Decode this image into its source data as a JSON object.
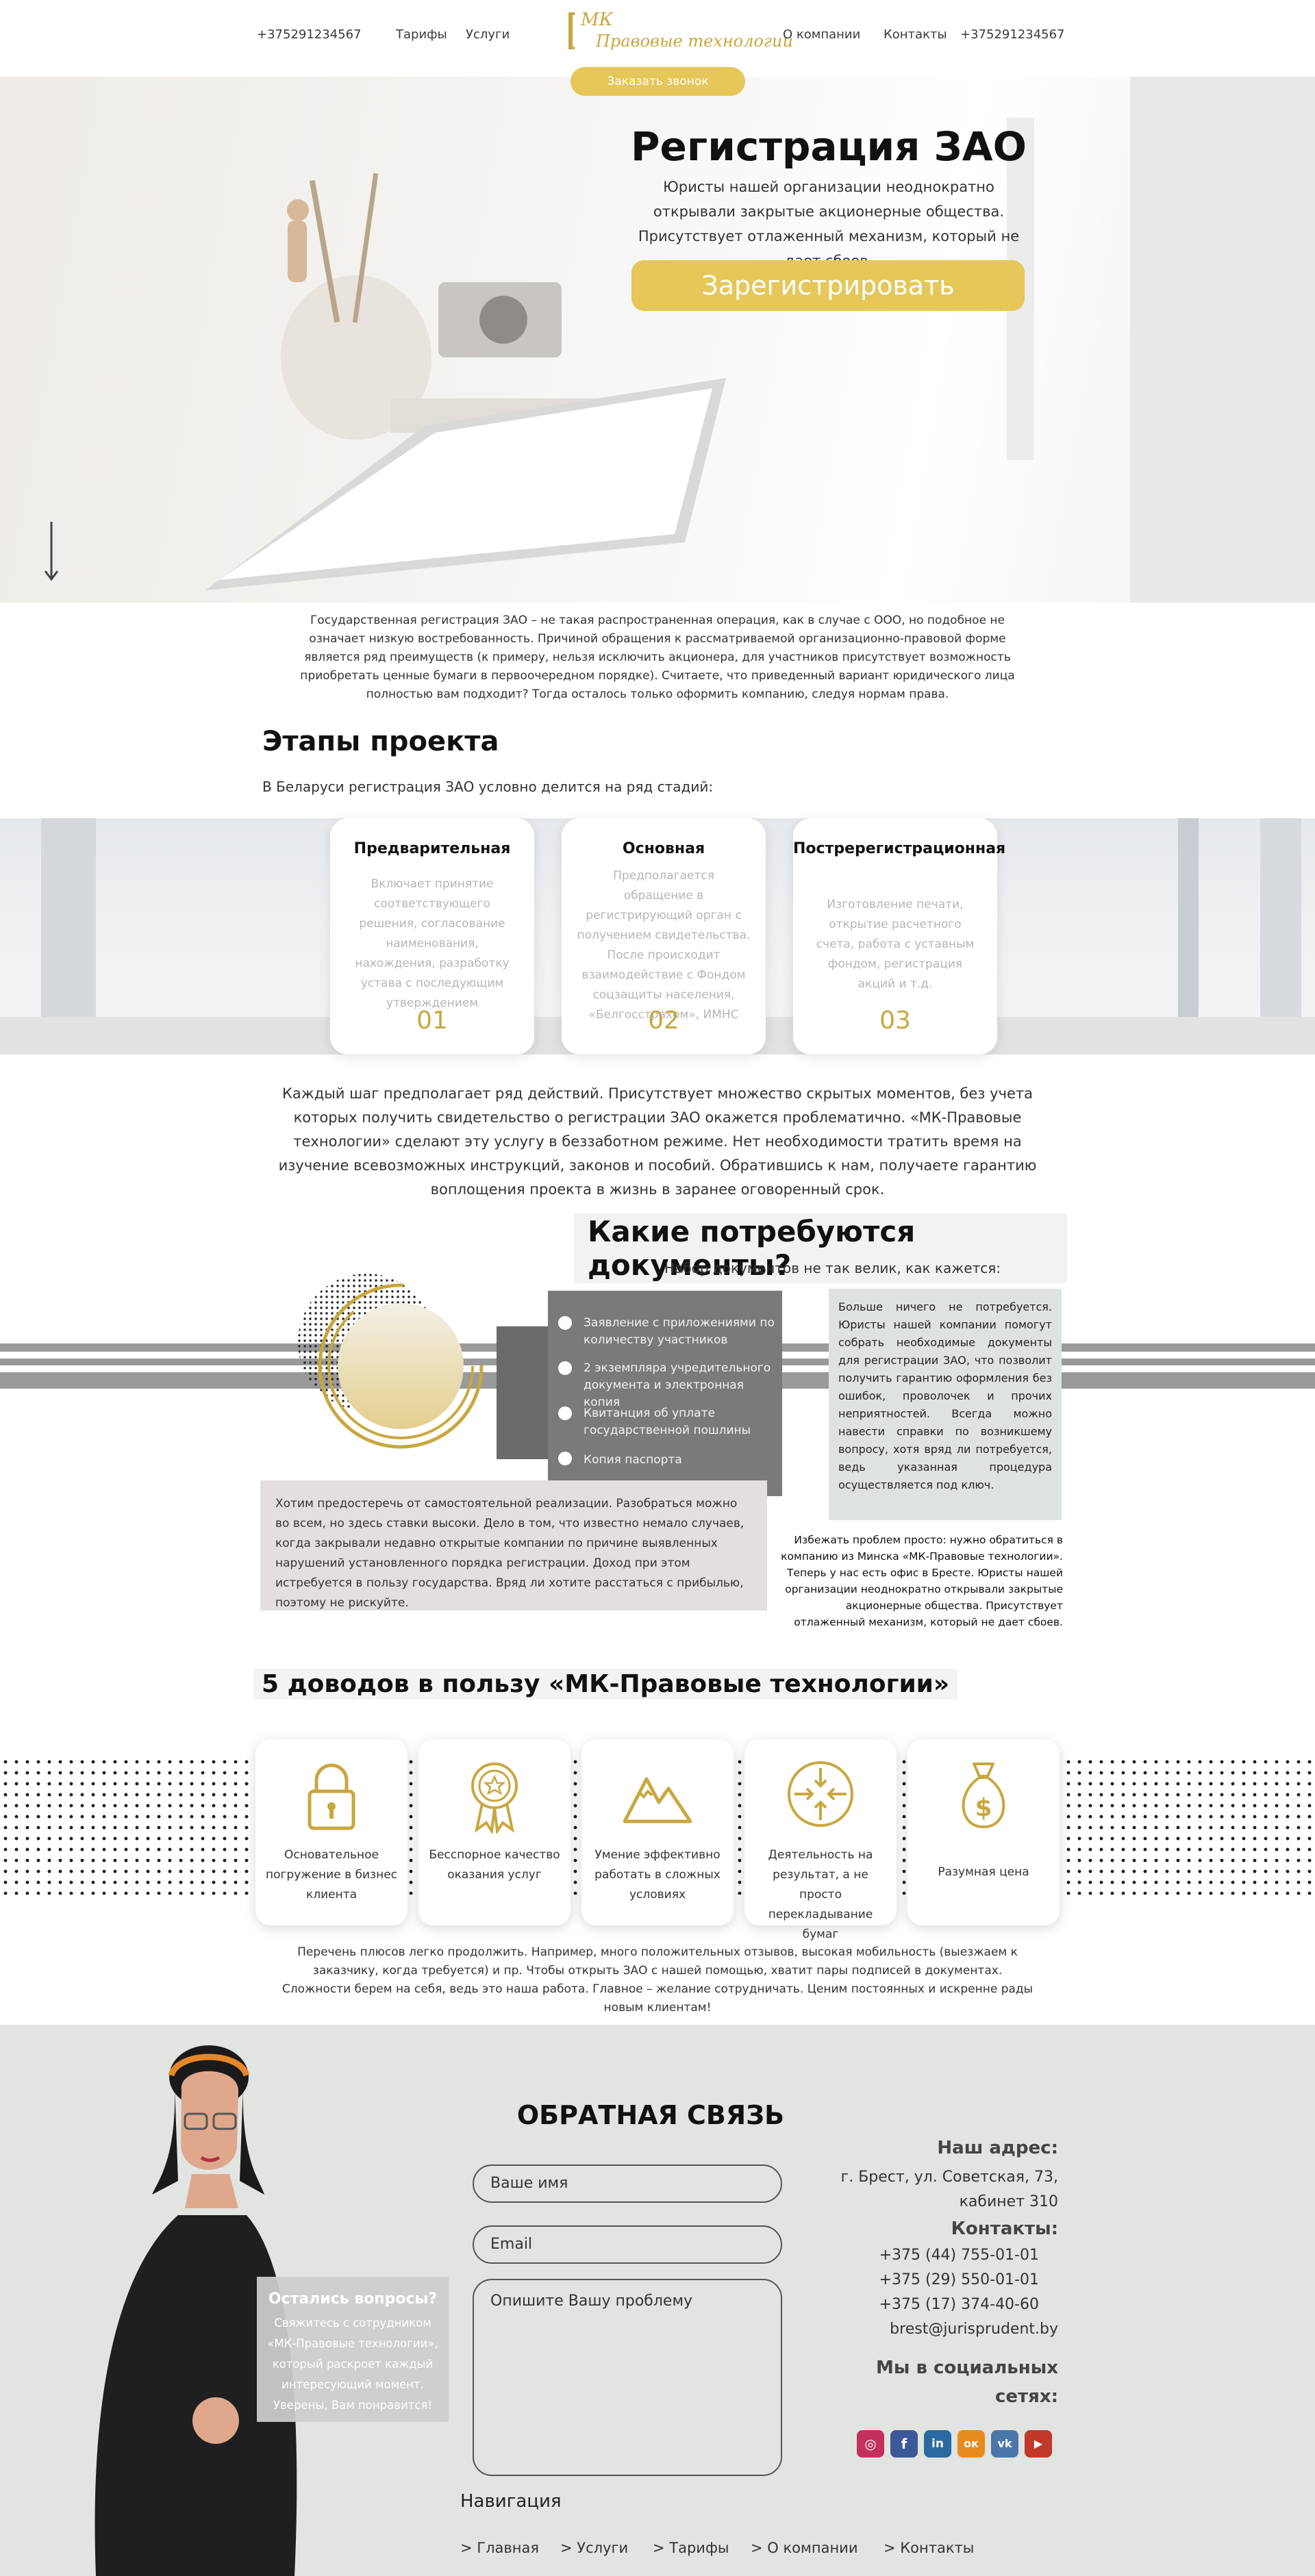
{
  "header": {
    "phone_left": "+375291234567",
    "nav_left": [
      "Тарифы",
      "Услуги"
    ],
    "logo_line1": "МК",
    "logo_line2": "Правовые технологии",
    "nav_right": [
      "О компании",
      "Контакты"
    ],
    "phone_right": "+375291234567",
    "call_button": "Заказать звонок"
  },
  "hero": {
    "title": "Регистрация ЗАО",
    "text": "Юристы нашей организации неоднократно открывали закрытые акционерные общества. Присутствует отлаженный механизм, который не дает сбоев.",
    "button": "Зарегистрировать",
    "scroll_icon": "arrow-down-icon"
  },
  "intro": "Государственная регистрация ЗАО – не такая распространенная операция, как в случае с ООО, но подобное не означает низкую востребованность. Причиной обращения к рассматриваемой организационно-правовой форме является ряд преимуществ (к примеру, нельзя исключить акционера, для участников присутствует возможность приобретать ценные бумаги в первоочередном порядке). Считаете, что приведенный вариант юридического лица полностью вам подходит? Тогда осталось только оформить компанию, следуя нормам права.",
  "stages": {
    "title": "Этапы проекта",
    "subtitle": "В Беларуси регистрация ЗАО условно делится на ряд стадий:",
    "cards": [
      {
        "title": "Предварительная",
        "text": "Включает принятие соответствующего решения, согласование наименования, нахождения, разработку устава с последующим утверждением",
        "num": "01"
      },
      {
        "title": "Основная",
        "text": "Предполагается обращение в регистрирующий орган с получением свидетельства. После происходит взаимодействие с Фондом соцзащиты населения, «Белгосстрахом», ИМНС",
        "num": "02"
      },
      {
        "title": "Постререгистрационная",
        "text": "Изготовление печати, открытие расчетного счета, работа с уставным фондом, регистрация акций и т.д.",
        "num": "03"
      }
    ],
    "after_text": "Каждый шаг предполагает ряд действий. Присутствует множество скрытых моментов, без учета которых получить свидетельство о регистрации ЗАО окажется проблематично. «МК-Правовые технологии» сделают эту услугу в беззаботном режиме. Нет необходимости тратить время на изучение всевозможных инструкций, законов и пособий. Обратившись к нам, получаете гарантию воплощения проекта в жизнь в заранее оговоренный срок."
  },
  "docs": {
    "title": "Какие потребуются документы?",
    "subtitle": "Набор документов не так велик, как кажется:",
    "items": [
      "Заявление с приложениями по количеству участников",
      "2 экземпляра учредительного документа и электронная копия",
      "Квитанция об уплате государственной пошлины",
      "Копия паспорта"
    ],
    "info": "Больше ничего не потребуется. Юристы нашей компании помогут собрать необходимые документы для регистрации ЗАО, что позволит получить гарантию оформления без ошибок, проволочек и прочих неприятностей. Всегда можно навести справки по возникшему вопросу, хотя вряд ли потребуется, ведь указанная процедура осуществляется под ключ.",
    "warning": "Хотим предостеречь от самостоятельной реализации. Разобраться можно во всем, но здесь ставки высоки. Дело в том, что известно немало случаев, когда закрывали недавно открытые компании по причине выявленных нарушений установленного порядка регистрации. Доход при этом истребуется в пользу государства. Вряд ли хотите расстаться с прибылью, поэтому не рискуйте.",
    "note": "Избежать проблем просто: нужно обратиться в компанию из Минска «МК-Правовые технологии». Теперь у нас есть офис в Бресте. Юристы нашей организации неоднократно открывали закрытые акционерные общества. Присутствует отлаженный механизм, который не дает сбоев."
  },
  "reasons": {
    "title": "5 доводов в пользу «МК-Правовые технологии»",
    "items": [
      {
        "icon": "lock-icon",
        "text": "Основательное погружение в бизнес клиента"
      },
      {
        "icon": "award-icon",
        "text": "Бесспорное качество оказания услуг"
      },
      {
        "icon": "mountains-icon",
        "text": "Умение эффективно работать в сложных условиях"
      },
      {
        "icon": "focus-arrows-icon",
        "text": "Деятельность на результат, а не просто перекладывание бумаг"
      },
      {
        "icon": "money-bag-icon",
        "text": "Разумная цена"
      }
    ],
    "after_text": "Перечень плюсов легко продолжить. Например, много положительных отзывов, высокая мобильность (выезжаем к заказчику, когда требуется) и пр. Чтобы открыть ЗАО с нашей помощью, хватит пары подписей в документах. Сложности берем на себя, ведь это наша работа. Главное – желание сотрудничать. Ценим постоянных и искренне рады новым клиентам!"
  },
  "feedback": {
    "title": "ОБРАТНАЯ СВЯЗЬ",
    "name_placeholder": "Ваше имя",
    "email_placeholder": "Email",
    "problem_placeholder": "Опишите Вашу проблему",
    "ask_title": "Остались вопросы?",
    "ask_text": "Свяжитесь с сотрудником «МК-Правовые технологии», который раскроет каждый интересующий момент. Уверены, Вам понравится!"
  },
  "contacts": {
    "address_title": "Наш адрес:",
    "address_line1": "г. Брест, ул. Советская, 73,",
    "address_line2": "кабинет 310",
    "contacts_title": "Контакты:",
    "phones": [
      "+375 (44) 755-01-01",
      "+375 (29) 550-01-01",
      "+375 (17) 374-40-60"
    ],
    "email": "brest@jurisprudent.by",
    "social_title_line1": "Мы в социальных",
    "social_title_line2": "сетях:",
    "social": [
      {
        "icon": "instagram-icon",
        "color": "#c4305c",
        "glyph": "◎"
      },
      {
        "icon": "facebook-icon",
        "color": "#3b5998",
        "glyph": "f"
      },
      {
        "icon": "linkedin-icon",
        "color": "#2a6aa0",
        "glyph": "in"
      },
      {
        "icon": "odnoklassniki-icon",
        "color": "#e78b1f",
        "glyph": "ок"
      },
      {
        "icon": "vk-icon",
        "color": "#4a76a8",
        "glyph": "vk"
      },
      {
        "icon": "youtube-icon",
        "color": "#c0392b",
        "glyph": "▶"
      }
    ]
  },
  "footer_nav": {
    "title": "Навигация",
    "links": [
      "> Главная",
      "> Услуги",
      "> Тарифы",
      "> О компании",
      "> Контакты"
    ]
  },
  "colors": {
    "accent": "#e5c75a",
    "gold": "#c9a73f",
    "gray_dark": "#7a7a7a"
  }
}
